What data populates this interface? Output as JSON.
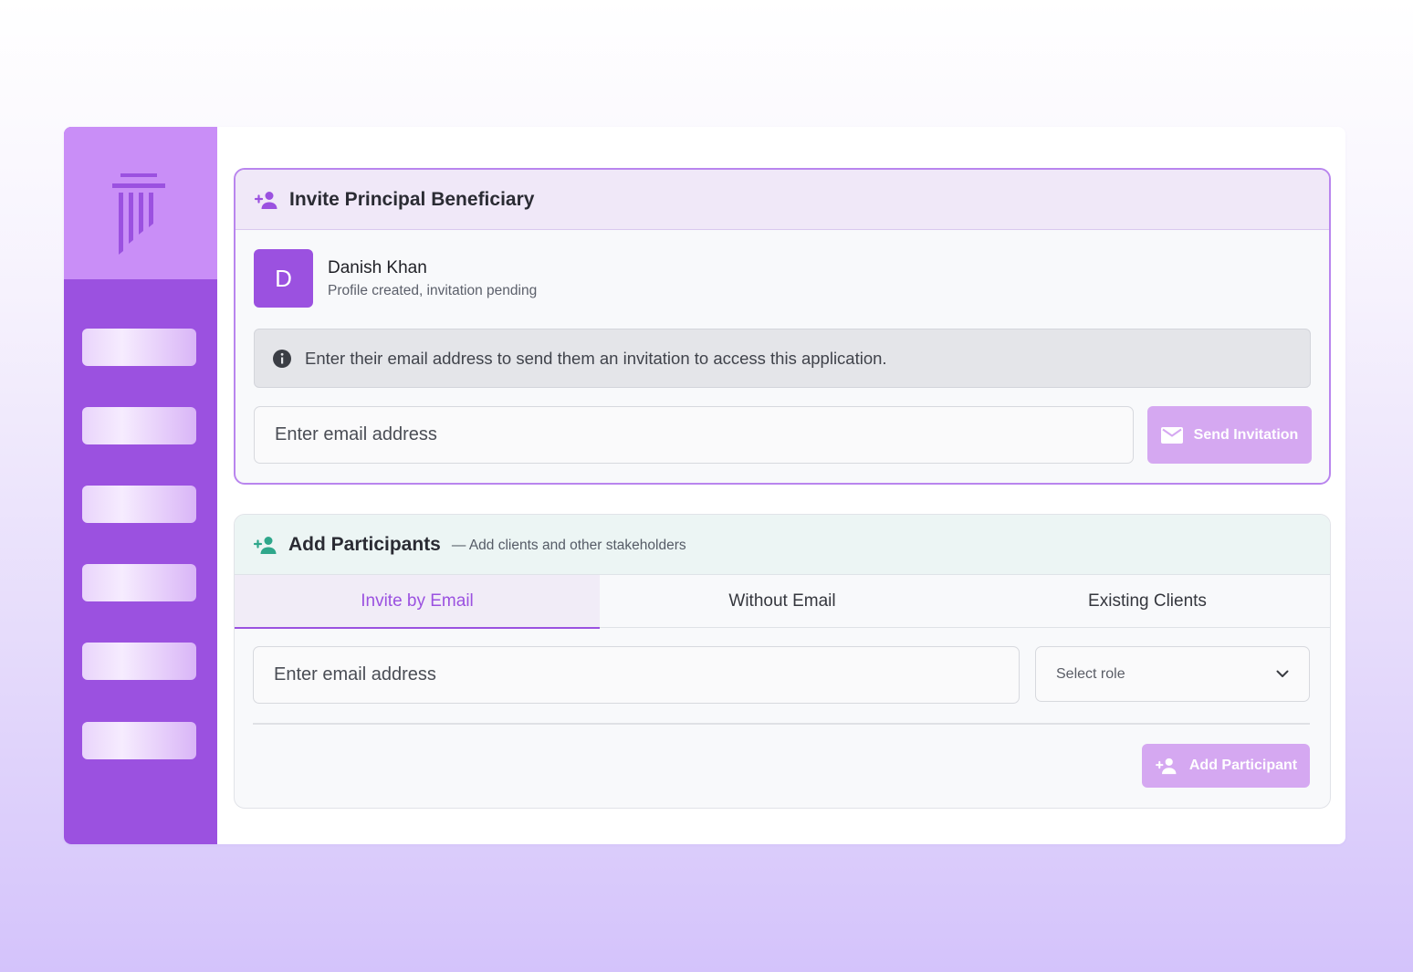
{
  "sidebar": {
    "logo_icon": "pillar-logo-icon",
    "nav_item_count_visible": 6
  },
  "invite_card": {
    "title": "Invite Principal Beneficiary",
    "title_icon": "add-person-icon",
    "person": {
      "avatar_letter": "D",
      "name": "Danish Khan",
      "status": "Profile created, invitation pending"
    },
    "info_text": "Enter their email address to send them an invitation to access this application.",
    "info_icon": "info-icon",
    "email_placeholder": "Enter email address",
    "send_button_label": "Send Invitation",
    "send_button_icon": "mail-icon"
  },
  "participants_card": {
    "title": "Add Participants",
    "subtitle": "— Add clients and other stakeholders",
    "title_icon": "add-person-icon",
    "tabs": [
      {
        "label": "Invite by Email",
        "active": true
      },
      {
        "label": "Without Email",
        "active": false
      },
      {
        "label": "Existing Clients",
        "active": false
      }
    ],
    "email_placeholder": "Enter email address",
    "role_select": {
      "placeholder": "Select role",
      "icon": "chevron-down-icon"
    },
    "add_button_label": "Add Participant",
    "add_button_icon": "add-person-icon"
  },
  "colors": {
    "primary": "#9b51e0",
    "primary_light": "#c98ef7",
    "button_disabled": "#d5a8f1",
    "teal_icon": "#2fa78b"
  }
}
